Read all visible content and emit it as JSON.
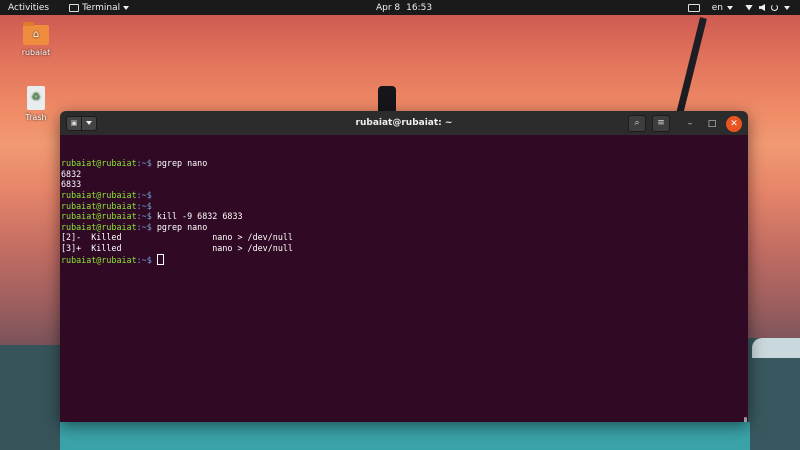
{
  "topbar": {
    "activities": "Activities",
    "app_name": "Terminal",
    "date": "Apr 8",
    "time": "16:53",
    "language": "en"
  },
  "desktop": {
    "icons": [
      {
        "label": "rubaiat"
      },
      {
        "label": "Trash"
      }
    ]
  },
  "terminal": {
    "title": "rubaiat@rubaiat: ~",
    "user_host": "rubaiat@rubaiat",
    "path": ":~$",
    "lines": [
      {
        "prompt": true,
        "cmd": " pgrep nano"
      },
      {
        "prompt": false,
        "text": "6832"
      },
      {
        "prompt": false,
        "text": "6833"
      },
      {
        "prompt": true,
        "cmd": ""
      },
      {
        "prompt": true,
        "cmd": ""
      },
      {
        "prompt": true,
        "cmd": " kill -9 6832 6833"
      },
      {
        "prompt": true,
        "cmd": " pgrep nano"
      },
      {
        "prompt": false,
        "text": "[2]-  Killed                  nano > /dev/null"
      },
      {
        "prompt": false,
        "text": "[3]+  Killed                  nano > /dev/null"
      },
      {
        "prompt": true,
        "cmd": " ",
        "cursor": true
      }
    ]
  },
  "colors": {
    "terminal_bg": "#300a24",
    "prompt_user": "#8ae234",
    "prompt_path": "#729fcf",
    "close_button": "#e95420"
  }
}
